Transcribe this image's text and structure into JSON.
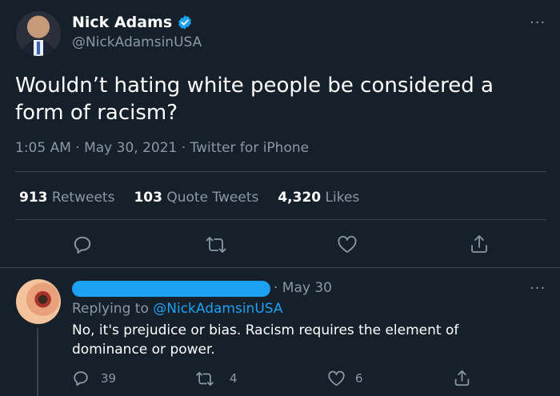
{
  "tweet": {
    "author_name": "Nick Adams",
    "author_handle": "@NickAdamsinUSA",
    "text": "Wouldn’t hating white people be considered a form of racism?",
    "meta": "1:05 AM · May 30, 2021 · Twitter for iPhone",
    "stats": {
      "retweets_count": "913",
      "retweets_label": "Retweets",
      "quotes_count": "103",
      "quotes_label": "Quote Tweets",
      "likes_count": "4,320",
      "likes_label": "Likes"
    },
    "more_label": "···"
  },
  "reply": {
    "date": "· May 30",
    "replying_prefix": "Replying to",
    "replying_handle": "@NickAdamsinUSA",
    "text": "No, it's prejudice or bias. Racism requires the element of dominance or power.",
    "reply_count": "39",
    "retweet_count": "4",
    "like_count": "6",
    "more_label": "···"
  },
  "colors": {
    "background": "#15202b",
    "accent": "#1da1f2",
    "muted": "#8899a6",
    "divider": "#38444d"
  }
}
